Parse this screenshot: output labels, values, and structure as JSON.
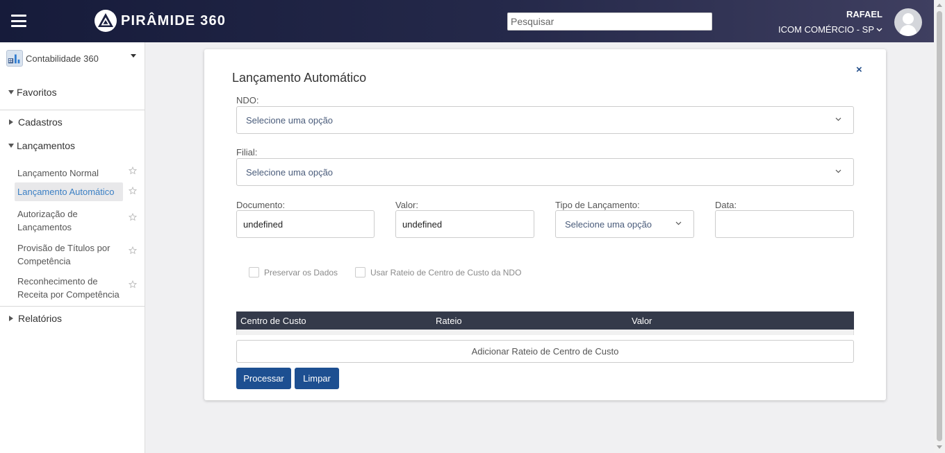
{
  "header": {
    "brand": "PIRÂMIDE 360",
    "search_placeholder": "Pesquisar",
    "user_name": "RAFAEL",
    "company": "ICOM COMÉRCIO - SP"
  },
  "sidebar": {
    "module": "Contabilidade 360",
    "sections": {
      "favoritos": "Favoritos",
      "cadastros": "Cadastros",
      "lancamentos": "Lançamentos",
      "relatorios": "Relatórios"
    },
    "items": [
      {
        "label": "Lançamento Normal",
        "active": false
      },
      {
        "label": "Lançamento Automático",
        "active": true
      },
      {
        "label": "Autorização de Lançamentos",
        "active": false
      },
      {
        "label": "Provisão de Títulos por Competência",
        "active": false
      },
      {
        "label": "Reconhecimento de Receita por Competência",
        "active": false
      }
    ]
  },
  "form": {
    "title": "Lançamento Automático",
    "close": "×",
    "ndo_label": "NDO:",
    "ndo_placeholder": "Selecione uma opção",
    "filial_label": "Filial:",
    "filial_placeholder": "Selecione uma opção",
    "documento_label": "Documento:",
    "documento_value": "undefined",
    "valor_label": "Valor:",
    "valor_value": "undefined",
    "tipo_label": "Tipo de Lançamento:",
    "tipo_placeholder": "Selecione uma opção",
    "data_label": "Data:",
    "data_value": "",
    "preservar_label": "Preservar os Dados",
    "usar_rateio_label": "Usar Rateio de Centro de Custo da NDO",
    "table_headers": [
      "Centro de Custo",
      "Rateio",
      "Valor"
    ],
    "add_rateio": "Adicionar Rateio de Centro de Custo",
    "processar": "Processar",
    "limpar": "Limpar"
  },
  "colors": {
    "header_start": "#161b3a",
    "header_end": "#3f3f60",
    "primary_button": "#1d4f91",
    "table_header": "#343a4a",
    "active_link": "#3a7fc4"
  }
}
